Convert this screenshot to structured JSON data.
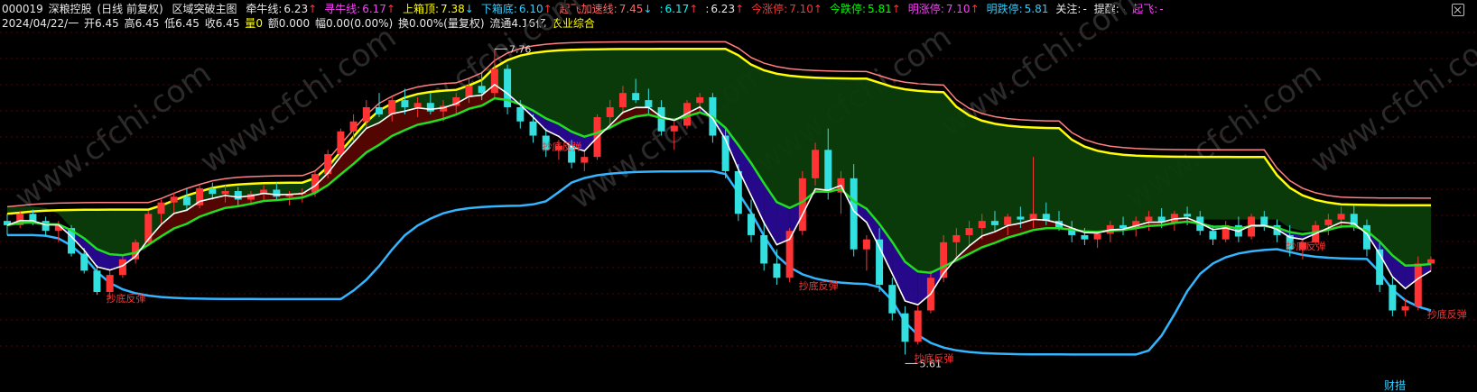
{
  "header": {
    "code": "000019",
    "name": "深粮控股",
    "period": "(日线 前复权)",
    "indicator": "区域突破主图",
    "items": [
      {
        "label": "牵牛线:",
        "value": "6.23",
        "arrow": "↑",
        "color": "#e8e8e8"
      },
      {
        "label": "寻牛线:",
        "value": "6.17",
        "arrow": "↑",
        "color": "#ff40ff"
      },
      {
        "label": "上箱顶:",
        "value": "7.38",
        "arrow": "↓",
        "color": "#ffff00"
      },
      {
        "label": "下箱底:",
        "value": "6.10",
        "arrow": "↑",
        "color": "#33ccff"
      },
      {
        "label": "起飞加速线:",
        "value": "7.45",
        "arrow": "↓",
        "color": "#ff6666"
      },
      {
        "label": ":",
        "value": "6.17",
        "arrow": "↑",
        "color": "#00ffff"
      },
      {
        "label": ":",
        "value": "6.23",
        "arrow": "↑",
        "color": "#e8e8e8"
      },
      {
        "label": "今涨停:",
        "value": "7.10",
        "arrow": "↑",
        "color": "#ff3333"
      },
      {
        "label": "今跌停:",
        "value": "5.81",
        "arrow": "↑",
        "color": "#00ff00"
      },
      {
        "label": "明涨停:",
        "value": "7.10",
        "arrow": "↑",
        "color": "#ff40ff"
      },
      {
        "label": "明跌停:",
        "value": "5.81",
        "arrow": "",
        "color": "#33ccff"
      },
      {
        "label": "关注:",
        "value": "-",
        "arrow": "",
        "color": "#e8e8e8"
      },
      {
        "label": "提醒:",
        "value": "-",
        "arrow": "",
        "color": "#e8e8e8"
      },
      {
        "label": "起飞:",
        "value": "-",
        "arrow": "",
        "color": "#ff40ff"
      }
    ]
  },
  "status": {
    "date": "2024/04/22/一",
    "open": "开6.45",
    "high": "高6.45",
    "low": "低6.45",
    "close": "收6.45",
    "volume_label": "量",
    "volume": "0",
    "amount": "额0.000",
    "change": "幅0.00(0.00%)",
    "turnover": "换0.00%(量复权)",
    "float": "流通4.16亿",
    "sector": "农业综合"
  },
  "chart_data": {
    "type": "candlestick",
    "price_high_label": "7.76",
    "price_low_label": "5.61",
    "annotation": "抄底反弹",
    "bottom_label": "财措",
    "colors": {
      "up": "#ff3333",
      "down": "#33e0e0",
      "box_fill": "#0b3d0b",
      "upper_box": "#ffff00",
      "lower_box": "#33b5ff",
      "accel": "#ff8080",
      "trend": "#22dd22",
      "fast": "#ffffff",
      "danger_fill": "#2a0a99",
      "hot_fill": "#5a0000"
    },
    "candles": [
      [
        6.55,
        6.6,
        6.45,
        6.52
      ],
      [
        6.52,
        6.62,
        6.5,
        6.6
      ],
      [
        6.6,
        6.63,
        6.52,
        6.55
      ],
      [
        6.55,
        6.58,
        6.44,
        6.48
      ],
      [
        6.48,
        6.55,
        6.4,
        6.52
      ],
      [
        6.5,
        6.52,
        6.3,
        6.32
      ],
      [
        6.32,
        6.36,
        6.18,
        6.2
      ],
      [
        6.2,
        6.24,
        6.03,
        6.05
      ],
      [
        6.05,
        6.2,
        6.0,
        6.17
      ],
      [
        6.17,
        6.3,
        6.15,
        6.28
      ],
      [
        6.28,
        6.42,
        6.25,
        6.4
      ],
      [
        6.4,
        6.62,
        6.38,
        6.6
      ],
      [
        6.6,
        6.7,
        6.52,
        6.68
      ],
      [
        6.68,
        6.75,
        6.6,
        6.72
      ],
      [
        6.72,
        6.78,
        6.62,
        6.66
      ],
      [
        6.66,
        6.8,
        6.64,
        6.78
      ],
      [
        6.78,
        6.82,
        6.7,
        6.74
      ],
      [
        6.74,
        6.8,
        6.68,
        6.76
      ],
      [
        6.76,
        6.79,
        6.66,
        6.7
      ],
      [
        6.7,
        6.76,
        6.66,
        6.74
      ],
      [
        6.74,
        6.8,
        6.7,
        6.77
      ],
      [
        6.77,
        6.82,
        6.7,
        6.72
      ],
      [
        6.72,
        6.76,
        6.66,
        6.74
      ],
      [
        6.74,
        6.78,
        6.68,
        6.75
      ],
      [
        6.75,
        6.9,
        6.72,
        6.88
      ],
      [
        6.88,
        7.05,
        6.85,
        7.02
      ],
      [
        7.02,
        7.2,
        7.0,
        7.18
      ],
      [
        7.18,
        7.3,
        7.1,
        7.25
      ],
      [
        7.25,
        7.4,
        7.2,
        7.35
      ],
      [
        7.35,
        7.45,
        7.28,
        7.3
      ],
      [
        7.3,
        7.42,
        7.25,
        7.4
      ],
      [
        7.4,
        7.48,
        7.3,
        7.35
      ],
      [
        7.35,
        7.42,
        7.28,
        7.38
      ],
      [
        7.38,
        7.45,
        7.3,
        7.32
      ],
      [
        7.32,
        7.4,
        7.25,
        7.36
      ],
      [
        7.36,
        7.45,
        7.3,
        7.42
      ],
      [
        7.42,
        7.55,
        7.38,
        7.5
      ],
      [
        7.5,
        7.6,
        7.4,
        7.45
      ],
      [
        7.45,
        7.76,
        7.42,
        7.62
      ],
      [
        7.62,
        7.65,
        7.3,
        7.35
      ],
      [
        7.35,
        7.4,
        7.2,
        7.25
      ],
      [
        7.25,
        7.3,
        7.1,
        7.15
      ],
      [
        7.15,
        7.2,
        7.0,
        7.05
      ],
      [
        7.05,
        7.12,
        6.98,
        7.08
      ],
      [
        7.08,
        7.12,
        6.92,
        6.96
      ],
      [
        6.96,
        7.05,
        6.9,
        7.0
      ],
      [
        7.0,
        7.3,
        6.98,
        7.28
      ],
      [
        7.28,
        7.4,
        7.22,
        7.35
      ],
      [
        7.35,
        7.5,
        7.3,
        7.45
      ],
      [
        7.45,
        7.55,
        7.38,
        7.4
      ],
      [
        7.4,
        7.48,
        7.3,
        7.35
      ],
      [
        7.35,
        7.4,
        7.15,
        7.18
      ],
      [
        7.18,
        7.25,
        7.05,
        7.22
      ],
      [
        7.22,
        7.4,
        7.2,
        7.38
      ],
      [
        7.38,
        7.45,
        7.32,
        7.42
      ],
      [
        7.42,
        7.45,
        7.1,
        7.15
      ],
      [
        7.15,
        7.2,
        6.85,
        6.9
      ],
      [
        6.9,
        6.95,
        6.55,
        6.6
      ],
      [
        6.6,
        6.7,
        6.4,
        6.45
      ],
      [
        6.45,
        6.55,
        6.2,
        6.25
      ],
      [
        6.25,
        6.35,
        6.1,
        6.15
      ],
      [
        6.15,
        6.5,
        6.12,
        6.48
      ],
      [
        6.48,
        6.9,
        6.45,
        6.85
      ],
      [
        6.85,
        7.1,
        6.8,
        7.05
      ],
      [
        7.05,
        7.2,
        6.7,
        6.75
      ],
      [
        6.75,
        6.9,
        6.6,
        6.85
      ],
      [
        6.85,
        6.95,
        6.3,
        6.35
      ],
      [
        6.35,
        6.45,
        6.2,
        6.42
      ],
      [
        6.42,
        6.5,
        6.05,
        6.1
      ],
      [
        6.1,
        6.15,
        5.85,
        5.9
      ],
      [
        5.9,
        5.95,
        5.61,
        5.7
      ],
      [
        5.7,
        5.95,
        5.68,
        5.92
      ],
      [
        5.92,
        6.2,
        5.9,
        6.15
      ],
      [
        6.15,
        6.45,
        6.12,
        6.4
      ],
      [
        6.4,
        6.5,
        6.3,
        6.45
      ],
      [
        6.45,
        6.55,
        6.38,
        6.5
      ],
      [
        6.5,
        6.6,
        6.42,
        6.55
      ],
      [
        6.55,
        6.62,
        6.48,
        6.52
      ],
      [
        6.52,
        6.6,
        6.45,
        6.58
      ],
      [
        6.58,
        6.65,
        6.5,
        6.56
      ],
      [
        6.56,
        7.0,
        6.5,
        6.6
      ],
      [
        6.6,
        6.68,
        6.52,
        6.55
      ],
      [
        6.55,
        6.62,
        6.48,
        6.5
      ],
      [
        6.5,
        6.55,
        6.4,
        6.45
      ],
      [
        6.45,
        6.5,
        6.38,
        6.42
      ],
      [
        6.42,
        6.48,
        6.36,
        6.46
      ],
      [
        6.46,
        6.55,
        6.4,
        6.52
      ],
      [
        6.52,
        6.58,
        6.45,
        6.5
      ],
      [
        6.5,
        6.58,
        6.44,
        6.55
      ],
      [
        6.55,
        6.62,
        6.48,
        6.58
      ],
      [
        6.58,
        6.64,
        6.5,
        6.54
      ],
      [
        6.54,
        6.62,
        6.48,
        6.6
      ],
      [
        6.6,
        6.65,
        6.52,
        6.58
      ],
      [
        6.58,
        6.62,
        6.45,
        6.48
      ],
      [
        6.48,
        6.52,
        6.38,
        6.42
      ],
      [
        6.42,
        6.55,
        6.4,
        6.52
      ],
      [
        6.52,
        6.58,
        6.4,
        6.44
      ],
      [
        6.44,
        6.6,
        6.42,
        6.58
      ],
      [
        6.58,
        6.62,
        6.48,
        6.52
      ],
      [
        6.52,
        6.56,
        6.4,
        6.45
      ],
      [
        6.45,
        6.52,
        6.3,
        6.35
      ],
      [
        6.35,
        6.42,
        6.28,
        6.4
      ],
      [
        6.4,
        6.55,
        6.38,
        6.52
      ],
      [
        6.52,
        6.6,
        6.45,
        6.56
      ],
      [
        6.56,
        6.65,
        6.5,
        6.6
      ],
      [
        6.6,
        6.66,
        6.48,
        6.52
      ],
      [
        6.52,
        6.56,
        6.3,
        6.35
      ],
      [
        6.35,
        6.4,
        6.05,
        6.1
      ],
      [
        6.1,
        6.15,
        5.88,
        5.92
      ],
      [
        5.92,
        6.0,
        5.88,
        5.95
      ],
      [
        5.95,
        6.3,
        5.92,
        6.25
      ],
      [
        6.25,
        6.3,
        6.2,
        6.28
      ]
    ]
  }
}
